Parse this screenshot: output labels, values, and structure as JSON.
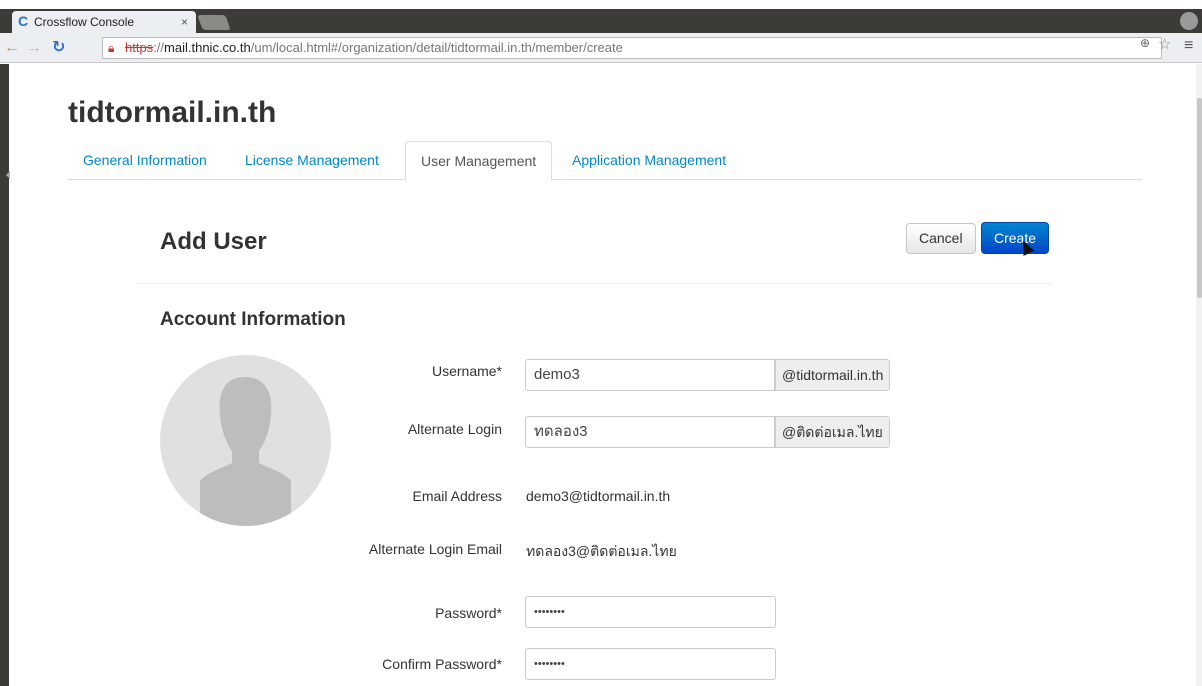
{
  "browser": {
    "tab_title": "Crossflow Console",
    "tab_close": "×",
    "url_scheme": "https",
    "url_host": "mail.thnic.co.th",
    "url_path": "/um/local.html#/organization/detail/tidtormail.in.th/member/create"
  },
  "page": {
    "org_title": "tidtormail.in.th",
    "tabs": [
      {
        "label": "General Information"
      },
      {
        "label": "License Management"
      },
      {
        "label": "User Management"
      },
      {
        "label": "Application Management"
      }
    ],
    "active_tab": "User Management",
    "add_user_title": "Add User",
    "cancel_label": "Cancel",
    "create_label": "Create",
    "section_title": "Account Information"
  },
  "form": {
    "username": {
      "label": "Username*",
      "value": "demo3",
      "suffix": "@tidtormail.in.th"
    },
    "alternate_login": {
      "label": "Alternate Login",
      "value": "ทดลอง3",
      "suffix": "@ติดต่อเมล.ไทย"
    },
    "email_address": {
      "label": "Email Address",
      "value": "demo3@tidtormail.in.th"
    },
    "alternate_login_email": {
      "label": "Alternate Login Email",
      "value": "ทดลอง3@ติดต่อเมล.ไทย"
    },
    "password": {
      "label": "Password*",
      "value": "••••••••"
    },
    "confirm_password": {
      "label": "Confirm Password*",
      "value": "••••••••"
    }
  },
  "icons": [
    "crossflow-favicon",
    "back-arrow-icon",
    "forward-arrow-icon",
    "reload-icon",
    "broken-lock-icon",
    "zoom-icon",
    "bookmark-star-icon",
    "menu-icon",
    "profile-icon",
    "default-avatar-icon"
  ]
}
